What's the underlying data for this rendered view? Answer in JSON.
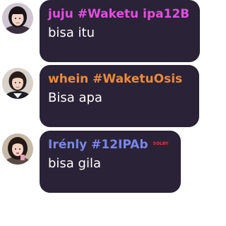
{
  "messages": [
    {
      "name": "juju #Waketu ipa12B",
      "name_color": "#e24fe0",
      "text": "bisa itu",
      "badge": ""
    },
    {
      "name": "whein #WaketuOsis",
      "name_color": "#f08a3a",
      "text": "Bisa apa",
      "badge": ""
    },
    {
      "name": "Irénly #12IPAb",
      "name_color": "#7a86ea",
      "text": "bisa gila",
      "badge": "SOLBY",
      "badge_color": "#d03a55"
    }
  ],
  "colors": {
    "bubble": "#2a2236",
    "message_text": "#ffffff"
  }
}
